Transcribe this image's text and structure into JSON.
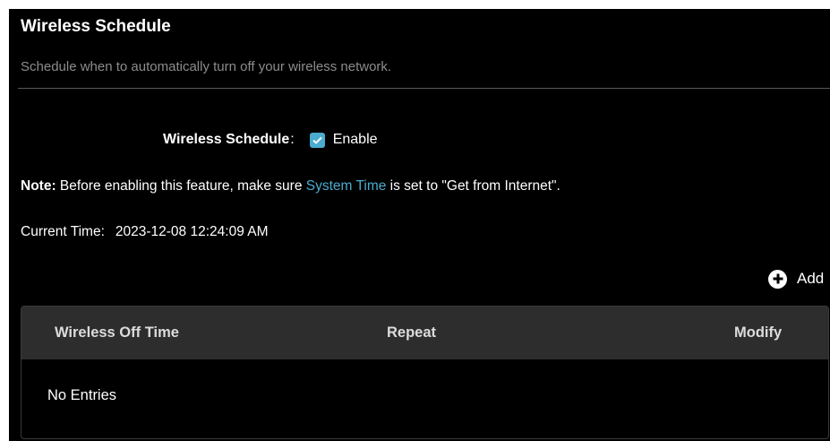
{
  "page": {
    "title": "Wireless Schedule",
    "description": "Schedule when to automatically turn off your wireless network."
  },
  "wireless_schedule": {
    "label": "Wireless Schedule",
    "colon": ":",
    "checkbox_checked": true,
    "enable_label": "Enable"
  },
  "note": {
    "prefix": "Note:",
    "text_before_link": " Before enabling this feature, make sure ",
    "link_text": "System Time",
    "text_after_link": " is set to \"Get from Internet\"."
  },
  "current_time": {
    "label": "Current Time:",
    "value": "2023-12-08 12:24:09 AM"
  },
  "add": {
    "label": "Add",
    "icon": "plus-circle-icon"
  },
  "table": {
    "columns": [
      "Wireless Off Time",
      "Repeat",
      "Modify"
    ],
    "empty_text": "No Entries"
  },
  "colors": {
    "background": "#000000",
    "accent": "#4aaccf",
    "header_bg": "#2d2d2d",
    "muted_text": "#8c8c8c"
  }
}
